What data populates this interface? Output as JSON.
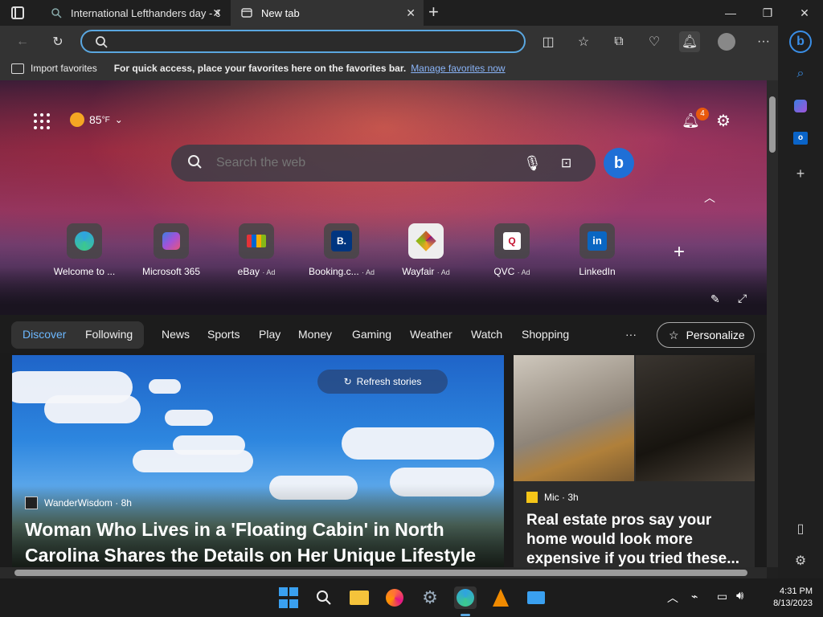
{
  "tabs": [
    {
      "title": "International Lefthanders day - S",
      "active": false
    },
    {
      "title": "New tab",
      "active": true
    }
  ],
  "address": {
    "value": "",
    "placeholder": ""
  },
  "favorites_bar": {
    "import_label": "Import favorites",
    "hint": "For quick access, place your favorites here on the favorites bar.",
    "manage_link": "Manage favorites now"
  },
  "weather": {
    "temp": "85",
    "unit": "°F"
  },
  "notifications": {
    "count": "4"
  },
  "web_search": {
    "placeholder": "Search the web"
  },
  "quick_links": [
    {
      "label": "Welcome to ...",
      "ad": "",
      "icon": "edge-icon"
    },
    {
      "label": "Microsoft 365",
      "ad": "",
      "icon": "m365-icon"
    },
    {
      "label": "eBay",
      "ad": "· Ad",
      "icon": "ebay-icon"
    },
    {
      "label": "Booking.c...",
      "ad": "· Ad",
      "icon": "booking-icon",
      "glyph": "B."
    },
    {
      "label": "Wayfair",
      "ad": "· Ad",
      "icon": "wayfair-icon"
    },
    {
      "label": "QVC",
      "ad": "· Ad",
      "icon": "qvc-icon",
      "glyph": "Q"
    },
    {
      "label": "LinkedIn",
      "ad": "",
      "icon": "linkedin-icon",
      "glyph": "in"
    }
  ],
  "feed_nav": {
    "pill": [
      "Discover",
      "Following"
    ],
    "items": [
      "News",
      "Sports",
      "Play",
      "Money",
      "Gaming",
      "Weather",
      "Watch",
      "Shopping"
    ],
    "more": "···",
    "personalize": "Personalize"
  },
  "refresh_label": "Refresh stories",
  "main_story": {
    "source": "WanderWisdom · 8h",
    "headline_line1": "Woman Who Lives in a 'Floating Cabin' in North",
    "headline_line2": "Carolina Shares the Details on Her Unique Lifestyle"
  },
  "side_story": {
    "source": "Mic · 3h",
    "headline_line1": "Real estate pros say your",
    "headline_line2": "home would look more",
    "headline_line3": "expensive if you tried these..."
  },
  "clock": {
    "time": "4:31 PM",
    "date": "8/13/2023"
  },
  "colors": {
    "accent": "#5aa7e0",
    "link": "#8ab4f8",
    "badge": "#e8590c"
  }
}
